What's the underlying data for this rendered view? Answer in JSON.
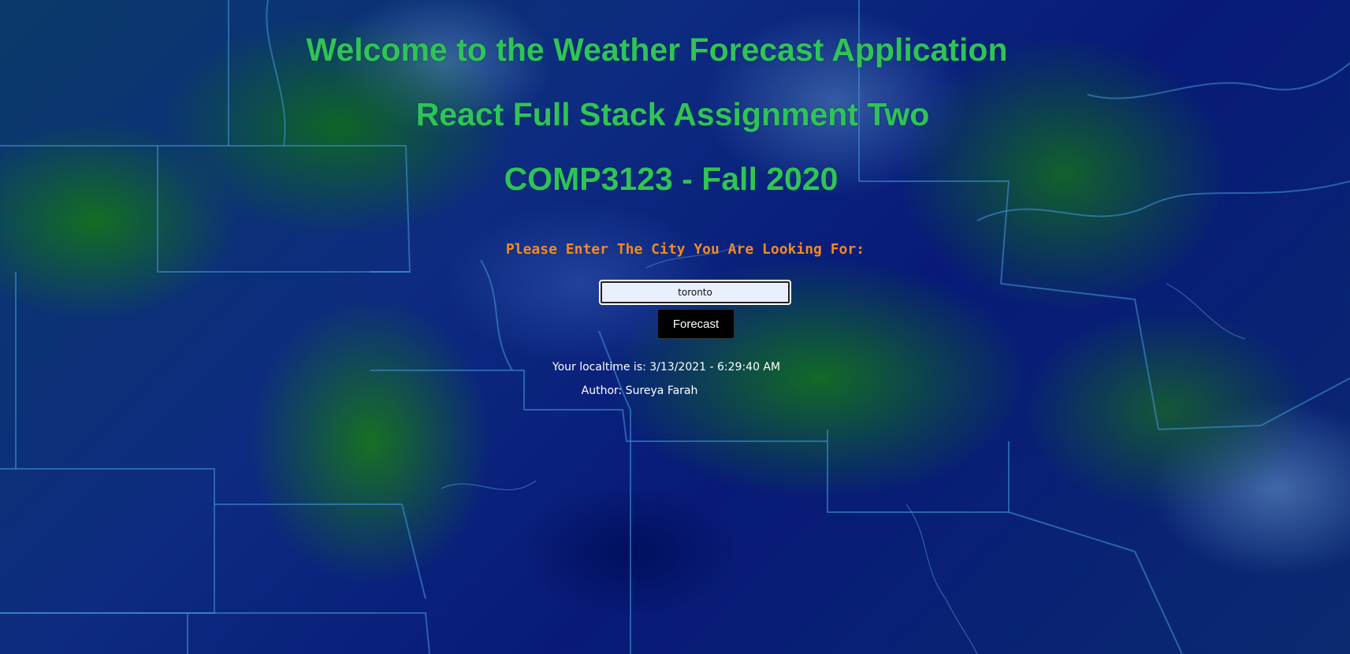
{
  "header": {
    "title_line1": "Welcome to the Weather Forecast Application",
    "title_line2": "React Full Stack Assignment Two",
    "title_line3": "COMP3123 - Fall 2020"
  },
  "search": {
    "prompt": "Please Enter The City You Are Looking For:",
    "city_value": "toronto",
    "button_label": "Forecast"
  },
  "footer": {
    "localtime": "Your localtime is: 3/13/2021 - 6:29:40 AM",
    "author": "Author: Sureya Farah"
  },
  "colors": {
    "title": "#2ec456",
    "prompt": "#f08a24",
    "button_bg": "#000000",
    "info_text": "#ffffff"
  }
}
